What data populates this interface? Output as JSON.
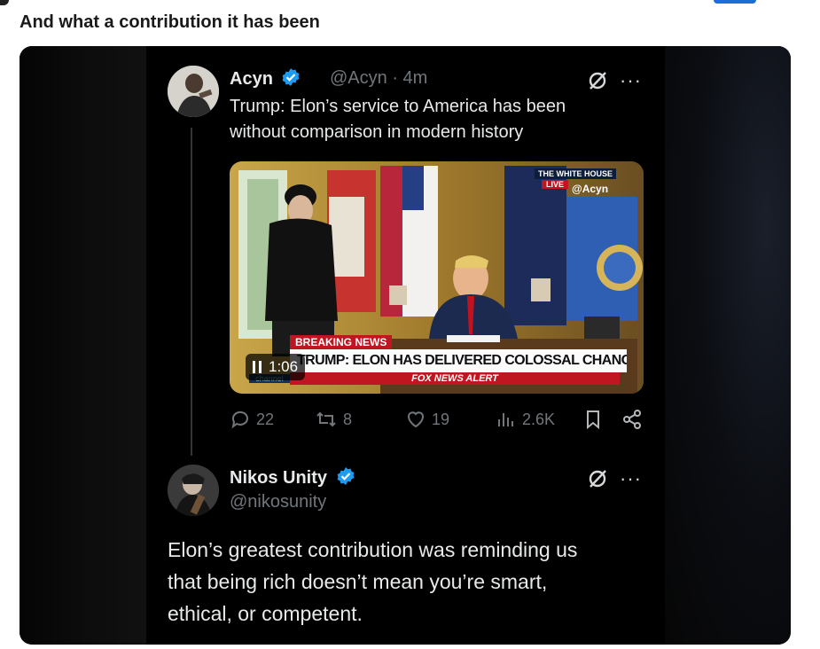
{
  "post": {
    "title": "And what a contribution it has been"
  },
  "quoted": {
    "name": "Acyn",
    "handle_time": "@Acyn · 4m",
    "text_line1": "Trump: Elon’s service to America has been",
    "text_line2": "without comparison in modern history",
    "video": {
      "time": "1:06",
      "breaking": "BREAKING NEWS",
      "headline": "TRUMP: ELON HAS DELIVERED COLOSSAL CHANGE",
      "alert": "FOX NEWS ALERT",
      "network_bug": "channel",
      "location": "THE WHITE HOUSE",
      "live": "LIVE",
      "watermark": "@Acyn"
    },
    "stats": {
      "replies": "22",
      "reposts": "8",
      "likes": "19",
      "views": "2.6K"
    }
  },
  "reply": {
    "name": "Nikos Unity",
    "handle": "@nikosunity",
    "text_line1": "Elon’s greatest contribution was reminding us",
    "text_line2": "that being rich doesn’t mean you’re smart,",
    "text_line3": "ethical, or competent."
  },
  "icons": [
    "verified-badge-icon",
    "grok-icon",
    "more-icon",
    "pause-icon",
    "reply-icon",
    "repost-icon",
    "like-icon",
    "views-icon",
    "bookmark-icon",
    "share-icon"
  ]
}
